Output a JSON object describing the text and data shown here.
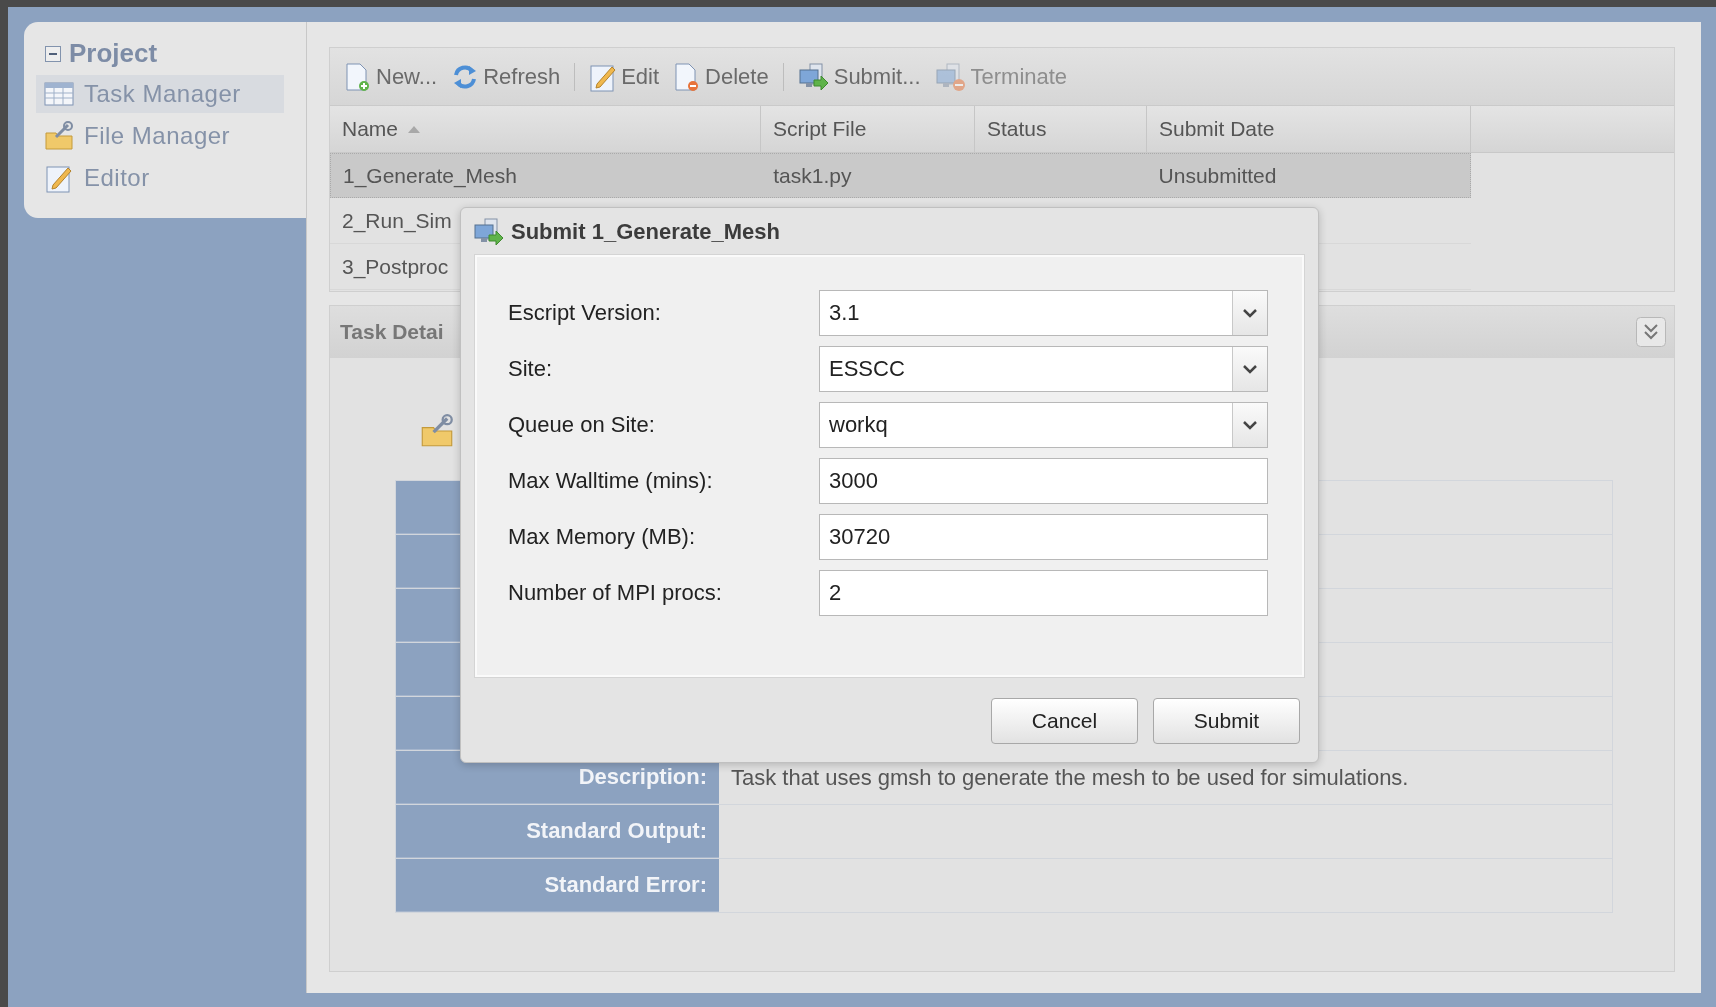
{
  "sidebar": {
    "title": "Project",
    "expanded": true,
    "items": [
      {
        "label": "Task Manager",
        "kind": "table",
        "selected": true
      },
      {
        "label": "File Manager",
        "kind": "folder",
        "selected": false
      },
      {
        "label": "Editor",
        "kind": "edit",
        "selected": false
      }
    ]
  },
  "toolbar": [
    {
      "label": "New...",
      "kind": "new",
      "disabled": false,
      "separator_before": false
    },
    {
      "label": "Refresh",
      "kind": "refresh",
      "disabled": false,
      "separator_before": false
    },
    {
      "label": "Edit",
      "kind": "edit",
      "disabled": false,
      "separator_before": true
    },
    {
      "label": "Delete",
      "kind": "delete",
      "disabled": false,
      "separator_before": false
    },
    {
      "label": "Submit...",
      "kind": "submit",
      "disabled": false,
      "separator_before": true
    },
    {
      "label": "Terminate",
      "kind": "terminate",
      "disabled": true,
      "separator_before": false
    }
  ],
  "grid": {
    "columns": [
      {
        "label": "Name",
        "sorted": true
      },
      {
        "label": "Script File"
      },
      {
        "label": "Status"
      },
      {
        "label": "Submit Date"
      }
    ],
    "rows": [
      {
        "name": "1_Generate_Mesh",
        "script_file": "task1.py",
        "submit_date": "Unsubmitted",
        "selected": true
      },
      {
        "name": "2_Run_Sim",
        "selected": false
      },
      {
        "name": "3_Postproc",
        "selected": false
      }
    ]
  },
  "details": {
    "title": "Task Detai",
    "rows": [
      {
        "label": "Description:",
        "value": "Task that uses gmsh to generate the mesh to be used for simulations."
      },
      {
        "label": "Standard Output:"
      },
      {
        "label": "Standard Error:"
      }
    ]
  },
  "dialog": {
    "title": "Submit 1_Generate_Mesh",
    "fields": [
      {
        "label": "Escript Version:",
        "value": "3.1",
        "kind": "combo"
      },
      {
        "label": "Site:",
        "value": "ESSCC",
        "kind": "combo"
      },
      {
        "label": "Queue on Site:",
        "value": "workq",
        "kind": "combo"
      },
      {
        "label": "Max Walltime (mins):",
        "value": "3000",
        "kind": "text"
      },
      {
        "label": "Max Memory (MB):",
        "value": "30720",
        "kind": "text"
      },
      {
        "label": "Number of MPI procs:",
        "value": "2",
        "kind": "text"
      }
    ],
    "buttons": [
      "Cancel",
      "Submit"
    ]
  }
}
